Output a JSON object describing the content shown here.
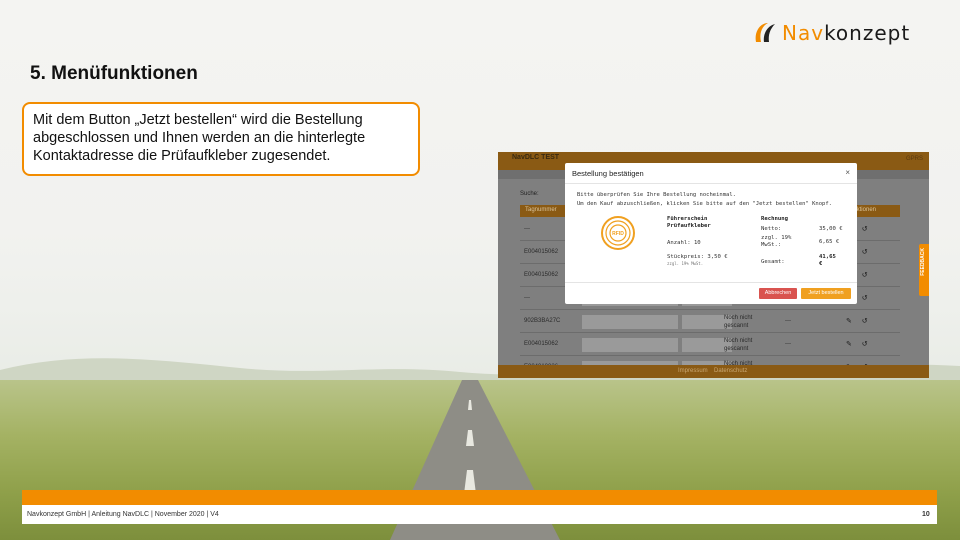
{
  "logo": {
    "part1": "Nav",
    "part2": "konzept"
  },
  "slide": {
    "title": "5. Menüfunktionen",
    "description": "Mit dem Button „Jetzt bestellen“ wird die Bestellung abgeschlossen und Ihnen werden an die hinterlegte Kontaktadresse die Prüfaufkleber zugesendet."
  },
  "app": {
    "title": "NavDLC TEST",
    "search_label": "Suche:",
    "table_header": "Tagnummer",
    "actions_header": "Aktionen",
    "rows": [
      {
        "id": "---",
        "status": "",
        "dash": ""
      },
      {
        "id": "E004015062",
        "status": "",
        "dash": ""
      },
      {
        "id": "E004015062",
        "status": "",
        "dash": ""
      },
      {
        "id": "---",
        "status": "",
        "dash": ""
      },
      {
        "id": "902B3BA27C",
        "status": "Noch nicht gescannt",
        "dash": "---"
      },
      {
        "id": "E004015062",
        "status": "Noch nicht gescannt",
        "dash": "---"
      },
      {
        "id": "E004010026",
        "status": "Noch nicht gescannt",
        "dash": "---"
      }
    ],
    "footer_links": [
      "Impressum",
      "Datenschutz"
    ],
    "feedback": "FEEDBACK",
    "gprs": "GPRS"
  },
  "modal": {
    "title": "Bestellung bestätigen",
    "close": "×",
    "line1": "Bitte überprüfen Sie Ihre Bestellung nocheinmal.",
    "line2": "Um den Kauf abzuschließen, klicken Sie bitte auf den \"Jetzt bestellen\" Knopf.",
    "badge_text": "RFID",
    "product_title": "Führerschein Prüfaufkleber",
    "quantity": "Anzahl: 10",
    "unit_price": "Stückpreis: 3,50 €",
    "unit_note": "zzgl. 19% MwSt.",
    "invoice_title": "Rechnung",
    "net_label": "Netto:",
    "net_value": "35,00 €",
    "vat_label": "zzgl. 19% MwSt.:",
    "vat_value": "6,65 €",
    "total_label": "Gesamt:",
    "total_value": "41,65 €",
    "cancel": "Abbrechen",
    "order": "Jetzt bestellen"
  },
  "footer": {
    "text": "Navkonzept GmbH  |  Anleitung NavDLC  |  November 2020  |  V4",
    "page": "10"
  },
  "colors": {
    "accent": "#f28c00"
  }
}
